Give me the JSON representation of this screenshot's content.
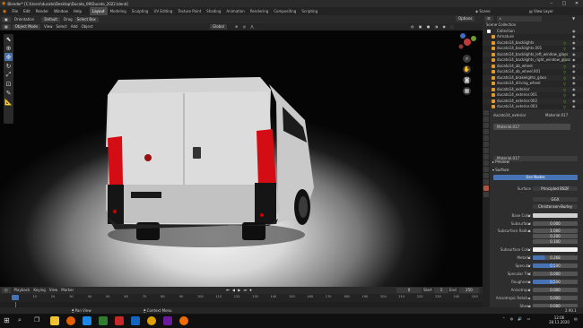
{
  "window": {
    "title": "Blender* [C:\\Users\\ducato\\Desktop\\Ducato_09\\Ducato_2022.blend]"
  },
  "menu": {
    "items": [
      "File",
      "Edit",
      "Render",
      "Window",
      "Help"
    ],
    "workspaces": [
      "Layout",
      "Modeling",
      "Sculpting",
      "UV Editing",
      "Texture Paint",
      "Shading",
      "Animation",
      "Rendering",
      "Compositing",
      "Scripting"
    ],
    "active_workspace": "Layout",
    "scene": "Scene",
    "view_layer": "View Layer"
  },
  "viewport_header": {
    "mode": "Object Mode",
    "view": "View",
    "select": "Select",
    "add": "Add",
    "object": "Object",
    "orientation": "Orientation",
    "orientation_value": "Default",
    "drag": "Drag",
    "drag_value": "Select Box",
    "transform": "Global",
    "options": "Options"
  },
  "outliner": {
    "title": "Scene Collection",
    "items": [
      "Collection",
      "Armature",
      "ducato14_backlights",
      "ducato14_backlights.001",
      "ducato14_backlights_left_window_glass",
      "ducato14_backlights_right_window_glass",
      "ducato14_ab_wheel",
      "ducato14_ab_wheel.001",
      "ducato14_brakelights_glass",
      "ducato14_driving_wheel",
      "ducato14_exterior",
      "ducato14_exterior.001",
      "ducato14_exterior.002",
      "ducato14_exterior.003"
    ]
  },
  "properties": {
    "object_name": "ducato14_exterior",
    "material_slot": "Material.017",
    "material_name": "Material.017",
    "sections": {
      "preview": "Preview",
      "surface": "Surface"
    },
    "use_nodes": "Use Nodes",
    "surface_label": "Surface",
    "surface_value": "Principled BSDF",
    "distribution": "GGX",
    "subsurface_method": "Christensen-Burley",
    "fields": [
      {
        "label": "Base Color",
        "value": ""
      },
      {
        "label": "Subsurface",
        "value": "0.000"
      },
      {
        "label": "Subsurface Radius",
        "value": "1.000"
      },
      {
        "label": "",
        "value": "0.200"
      },
      {
        "label": "",
        "value": "0.100"
      },
      {
        "label": "Subsurface Color",
        "value": ""
      },
      {
        "label": "Metallic",
        "value": "0.268"
      },
      {
        "label": "Specular",
        "value": "0.500"
      },
      {
        "label": "Specular Tint",
        "value": "0.000"
      },
      {
        "label": "Roughness",
        "value": "0.500"
      },
      {
        "label": "Anisotropic",
        "value": "0.000"
      },
      {
        "label": "Anisotropic Rotati...",
        "value": "0.000"
      },
      {
        "label": "Sheen",
        "value": "0.000"
      }
    ],
    "metallic_fill": 0.268,
    "specular_fill": 0.5,
    "roughness_fill": 0.5
  },
  "timeline": {
    "playback": "Playback",
    "keying": "Keying",
    "view": "View",
    "marker": "Marker",
    "current_frame": "0",
    "start_label": "Start",
    "start": "1",
    "end_label": "End",
    "end": "250",
    "ticks": [
      "0",
      "10",
      "20",
      "30",
      "40",
      "50",
      "60",
      "70",
      "80",
      "90",
      "100",
      "110",
      "120",
      "130",
      "140",
      "150",
      "160",
      "170",
      "180",
      "190",
      "200",
      "210",
      "220",
      "230",
      "240",
      "250"
    ]
  },
  "statusbar": {
    "left": "Pan View",
    "mid": "Context Menu",
    "version": "2.90.1"
  },
  "taskbar": {
    "time": "12:06",
    "date": "28.11.2020"
  }
}
